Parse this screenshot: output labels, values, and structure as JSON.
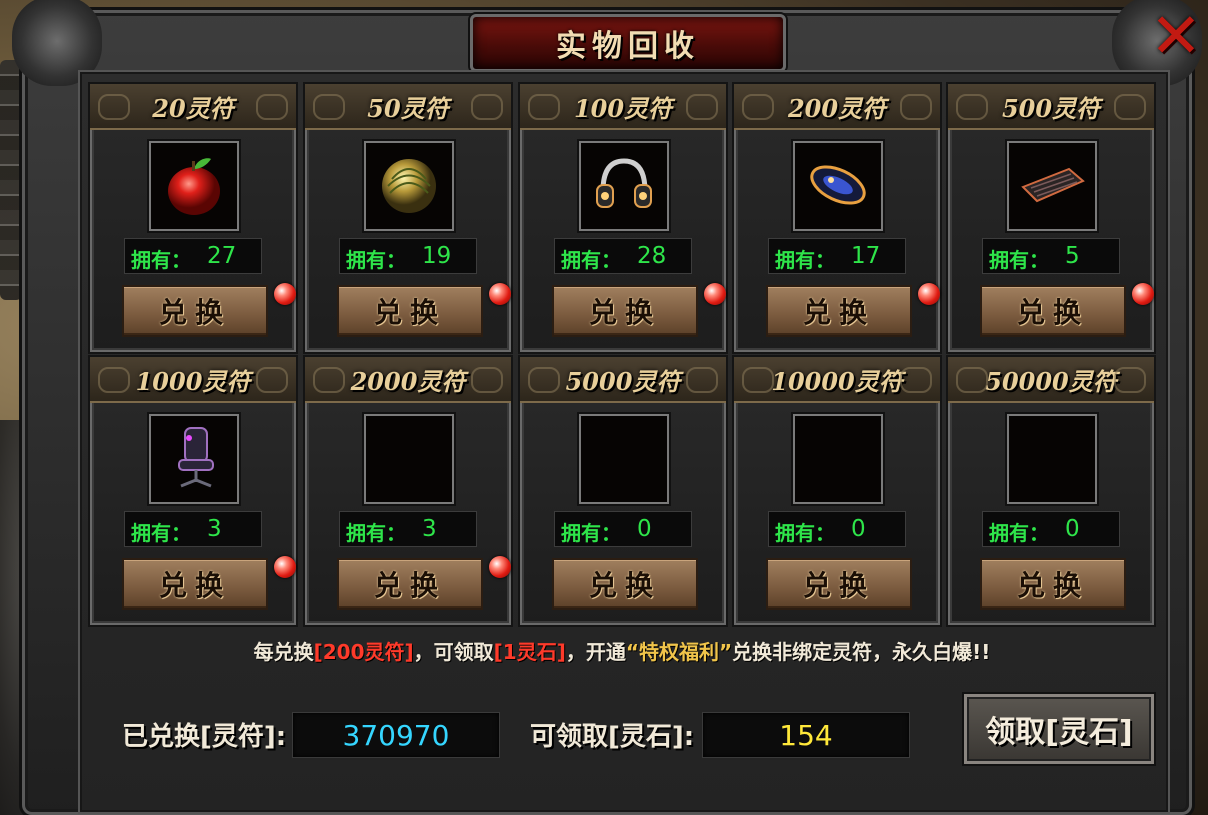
{
  "window": {
    "title": "实物回收",
    "close": "✕"
  },
  "cards": [
    {
      "title": "20灵符",
      "item": "apple",
      "own_label": "拥有：",
      "own_value": "27",
      "button": "兑换",
      "has_dot": true
    },
    {
      "title": "50灵符",
      "item": "melon",
      "own_label": "拥有：",
      "own_value": "19",
      "button": "兑换",
      "has_dot": true
    },
    {
      "title": "100灵符",
      "item": "headphones",
      "own_label": "拥有：",
      "own_value": "28",
      "button": "兑换",
      "has_dot": true
    },
    {
      "title": "200灵符",
      "item": "mouse",
      "own_label": "拥有：",
      "own_value": "17",
      "button": "兑换",
      "has_dot": true
    },
    {
      "title": "500灵符",
      "item": "keyboard",
      "own_label": "拥有：",
      "own_value": "5",
      "button": "兑换",
      "has_dot": true
    },
    {
      "title": "1000灵符",
      "item": "chair",
      "own_label": "拥有：",
      "own_value": "3",
      "button": "兑换",
      "has_dot": true
    },
    {
      "title": "2000灵符",
      "item": "empty",
      "own_label": "拥有：",
      "own_value": "3",
      "button": "兑换",
      "has_dot": true
    },
    {
      "title": "5000灵符",
      "item": "empty",
      "own_label": "拥有：",
      "own_value": "0",
      "button": "兑换",
      "has_dot": false
    },
    {
      "title": "10000灵符",
      "item": "empty",
      "own_label": "拥有：",
      "own_value": "0",
      "button": "兑换",
      "has_dot": false
    },
    {
      "title": "50000灵符",
      "item": "empty",
      "own_label": "拥有：",
      "own_value": "0",
      "button": "兑换",
      "has_dot": false
    }
  ],
  "info": {
    "part1": "每兑换",
    "part2": "[200灵符]",
    "part3": "，可领取",
    "part4": "[1灵石]",
    "part5": "，开通",
    "part6": "“特权福利”",
    "part7": "兑换非绑定灵符，永久白爆!!"
  },
  "stats": {
    "exchanged_label": "已兑换[灵符]:",
    "exchanged_value": "370970",
    "claimable_label": "可领取[灵石]:",
    "claimable_value": "154",
    "claim_button": "领取[灵石]"
  },
  "colors": {
    "own_text": "#2ee54a",
    "exchanged_value": "#35d6ff",
    "claimable_value": "#ffe83a",
    "highlight_red": "#ff3a2a",
    "highlight_gold": "#f0c44a"
  }
}
